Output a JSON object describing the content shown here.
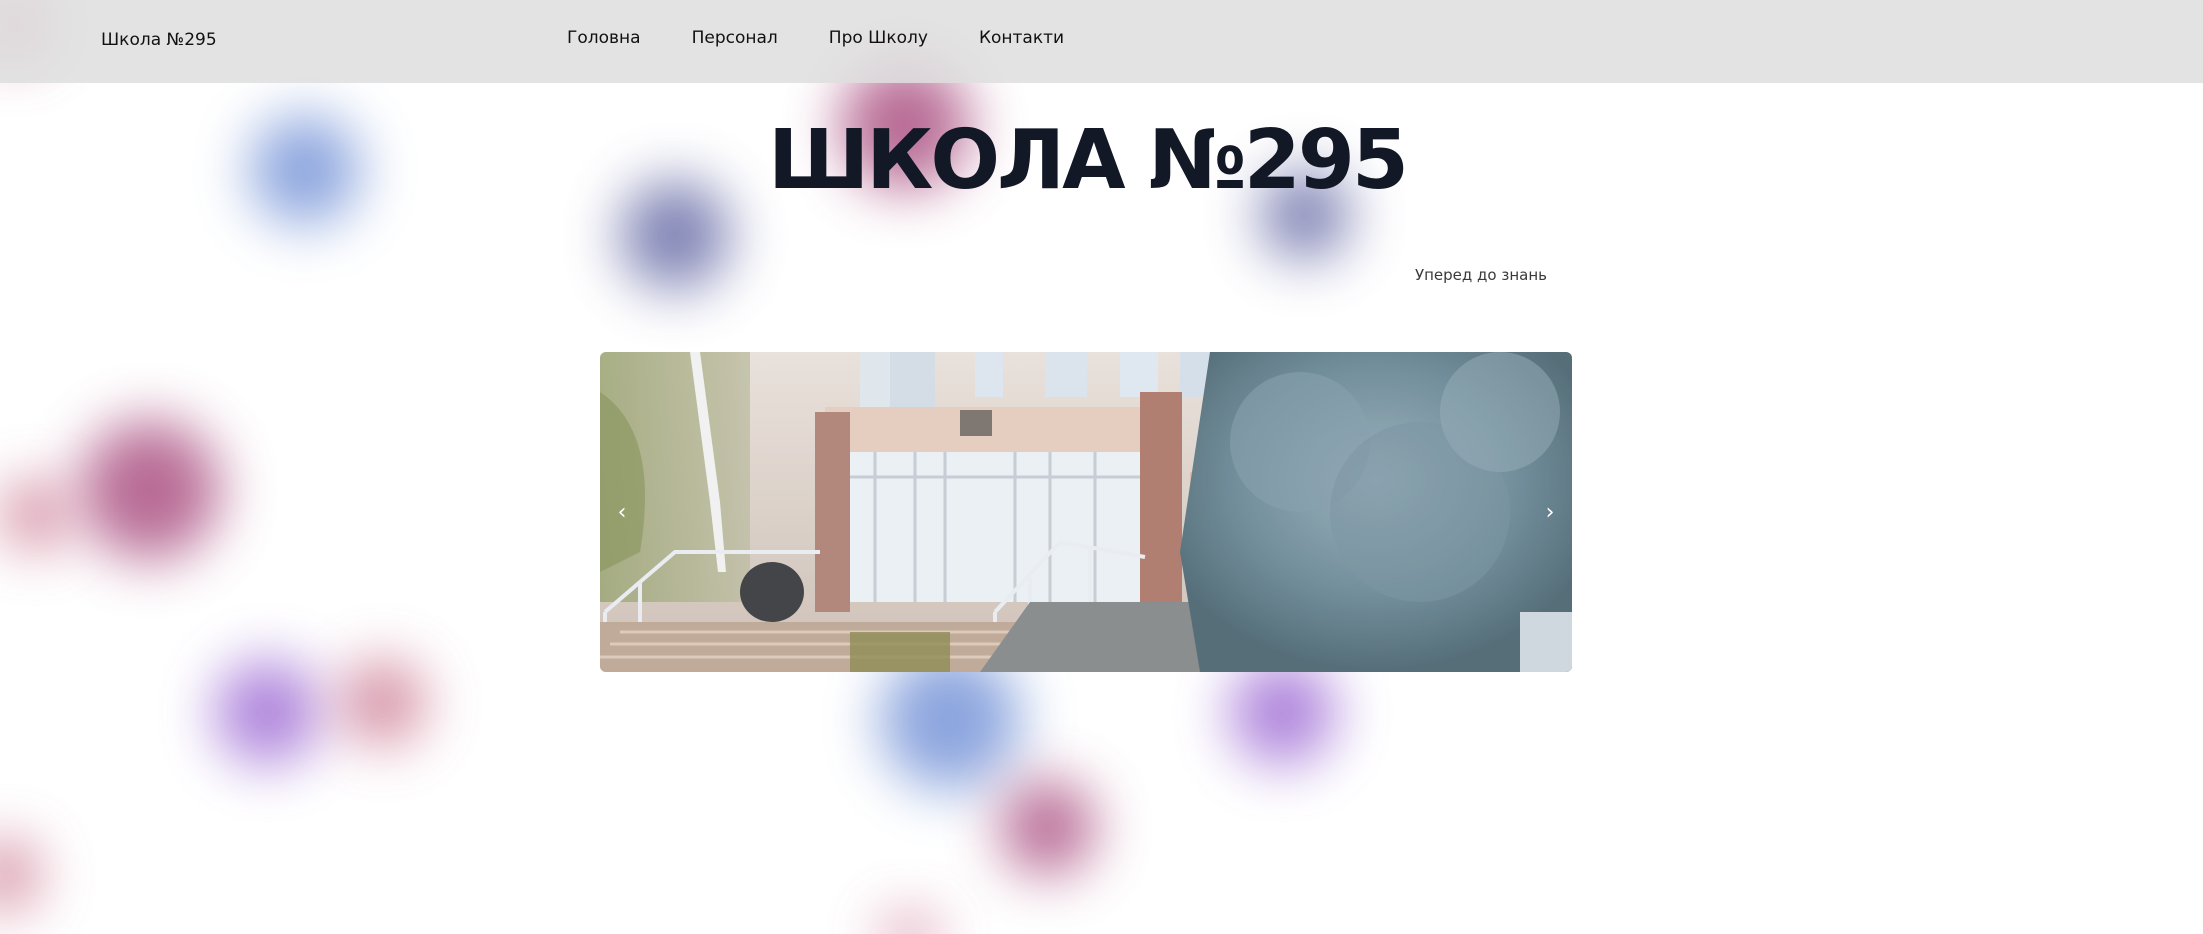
{
  "header": {
    "brand": "Школа №295",
    "nav": [
      "Головна",
      "Персонал",
      "Про Школу",
      "Контакти"
    ]
  },
  "hero": {
    "title": "ШКОЛА №295",
    "subtitle": "Уперед до знань"
  },
  "carousel": {
    "prev_icon": "chevron-left-icon",
    "next_icon": "chevron-right-icon",
    "prev_glyph": "‹",
    "next_glyph": "›"
  },
  "colors": {
    "header_bg": "#dedede",
    "title": "#121826",
    "blob_blue": "#5b7fd0",
    "blob_plum": "#9a2d68",
    "blob_violet": "#8b4fcc"
  }
}
